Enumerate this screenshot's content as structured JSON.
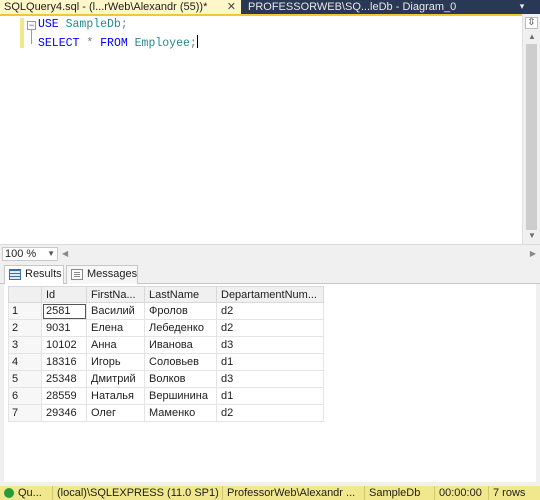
{
  "tabs": [
    {
      "label": "SQLQuery4.sql - (l...rWeb\\Alexandr (55))*",
      "close": "✕"
    },
    {
      "label": "PROFESSORWEB\\SQ...leDb - Diagram_0"
    }
  ],
  "tab_dropdown": "▾",
  "editor": {
    "line1": {
      "keyword": "USE",
      "identifier": "SampleDb",
      "punct": ";"
    },
    "line2": {
      "keyword1": "SELECT",
      "star": "*",
      "keyword2": "FROM",
      "identifier": "Employee",
      "punct": ";"
    },
    "collapse_glyph": "−"
  },
  "zoom": {
    "value": "100 %"
  },
  "results_tabs": {
    "results": "Results",
    "messages": "Messages"
  },
  "grid": {
    "columns": [
      "Id",
      "FirstNa...",
      "LastName",
      "DepartamentNum..."
    ],
    "rows": [
      {
        "n": "1",
        "id": "2581",
        "first": "Василий",
        "last": "Фролов",
        "dept": "d2"
      },
      {
        "n": "2",
        "id": "9031",
        "first": "Елена",
        "last": "Лебеденко",
        "dept": "d2"
      },
      {
        "n": "3",
        "id": "10102",
        "first": "Анна",
        "last": "Иванова",
        "dept": "d3"
      },
      {
        "n": "4",
        "id": "18316",
        "first": "Игорь",
        "last": "Соловьев",
        "dept": "d1"
      },
      {
        "n": "5",
        "id": "25348",
        "first": "Дмитрий",
        "last": "Волков",
        "dept": "d3"
      },
      {
        "n": "6",
        "id": "28559",
        "first": "Наталья",
        "last": "Вершинина",
        "dept": "d1"
      },
      {
        "n": "7",
        "id": "29346",
        "first": "Олег",
        "last": "Маменко",
        "dept": "d2"
      }
    ]
  },
  "status": {
    "state": "Qu...",
    "server": "(local)\\SQLEXPRESS (11.0 SP1)",
    "user": "ProfessorWeb\\Alexandr ...",
    "database": "SampleDb",
    "time": "00:00:00",
    "rows": "7 rows"
  },
  "colors": {
    "tabbar": "#293955",
    "active_tab": "#fff6c9",
    "statusbar": "#f1e88e",
    "keyword": "#0000ff",
    "identifier": "#2b8a8a"
  }
}
